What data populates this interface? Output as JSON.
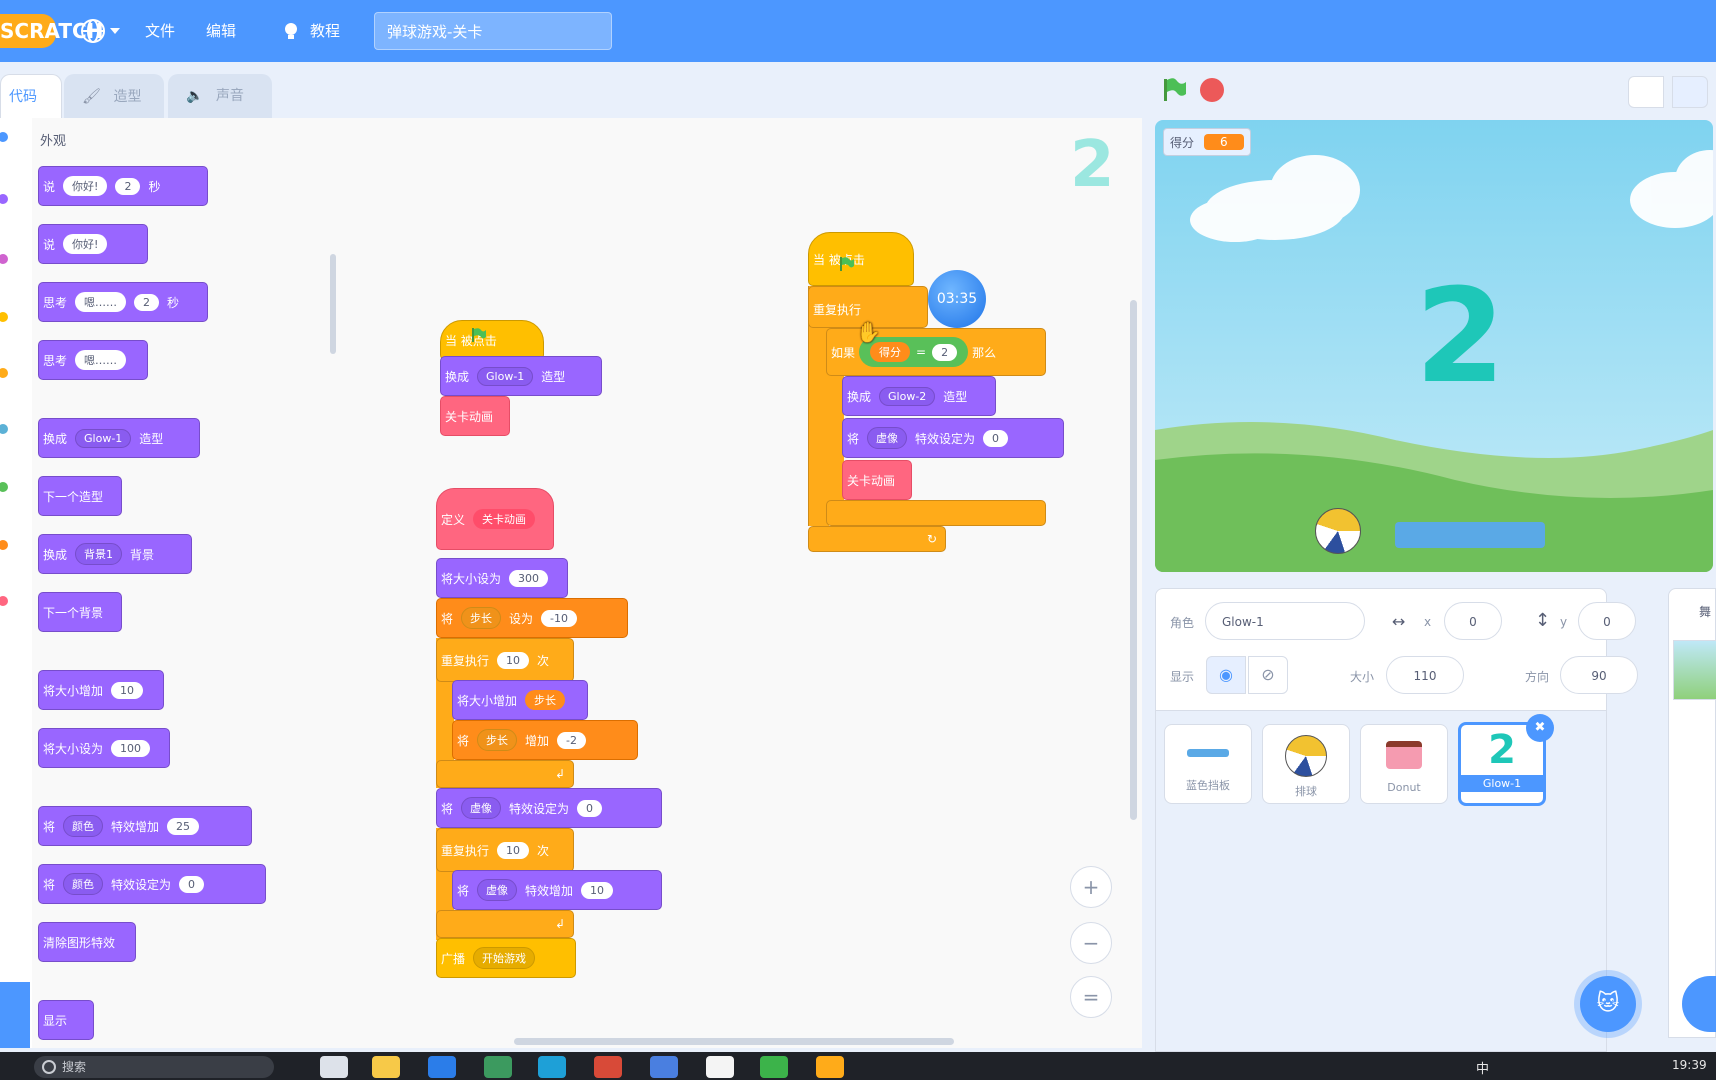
{
  "menubar": {
    "logo": "SCRATCH",
    "file": "文件",
    "edit": "编辑",
    "tutorials": "教程",
    "project_title": "弹球游戏-关卡"
  },
  "tabs": {
    "code": "代码",
    "costumes": "造型",
    "sounds": "声音"
  },
  "palette": {
    "category": "外观",
    "say_secs": {
      "op": "说",
      "text": "你好!",
      "secs": "2",
      "unit": "秒"
    },
    "say": {
      "op": "说",
      "text": "你好!"
    },
    "think_secs": {
      "op": "思考",
      "text": "嗯……",
      "secs": "2",
      "unit": "秒"
    },
    "think": {
      "op": "思考",
      "text": "嗯……"
    },
    "switch_costume": {
      "op": "换成",
      "value": "Glow-1",
      "suffix": "造型"
    },
    "next_costume": "下一个造型",
    "switch_backdrop": {
      "op": "换成",
      "value": "背景1",
      "suffix": "背景"
    },
    "next_backdrop": "下一个背景",
    "change_size": {
      "op": "将大小增加",
      "value": "10"
    },
    "set_size": {
      "op": "将大小设为",
      "value": "100"
    },
    "change_effect": {
      "op": "将",
      "effect": "颜色",
      "mid": "特效增加",
      "value": "25"
    },
    "set_effect": {
      "op": "将",
      "effect": "颜色",
      "mid": "特效设定为",
      "value": "0"
    },
    "clear_effects": "清除图形特效",
    "show": "显示"
  },
  "script1": {
    "hat": "当  被点击",
    "switch": {
      "op": "换成",
      "value": "Glow-1",
      "suffix": "造型"
    },
    "call": "关卡动画"
  },
  "script2": {
    "define": "定义",
    "define_name": "关卡动画",
    "set_size": {
      "op": "将大小设为",
      "value": "300"
    },
    "set_var": {
      "op": "将",
      "var": "步长",
      "mid": "设为",
      "value": "-10"
    },
    "repeat1": {
      "op": "重复执行",
      "value": "10",
      "suffix": "次"
    },
    "change_size": {
      "op": "将大小增加",
      "var": "步长"
    },
    "change_var": {
      "op": "将",
      "var": "步长",
      "mid": "增加",
      "value": "-2"
    },
    "set_ghost": {
      "op": "将",
      "effect": "虚像",
      "mid": "特效设定为",
      "value": "0"
    },
    "repeat2": {
      "op": "重复执行",
      "value": "10",
      "suffix": "次"
    },
    "change_ghost": {
      "op": "将",
      "effect": "虚像",
      "mid": "特效增加",
      "value": "10"
    },
    "broadcast": {
      "op": "广播",
      "value": "开始游戏"
    }
  },
  "script3": {
    "hat": "当  被点击",
    "forever": "重复执行",
    "if": "如果",
    "var": "得分",
    "eq": "=",
    "value": "2",
    "then": "那么",
    "switch": {
      "op": "换成",
      "value": "Glow-2",
      "suffix": "造型"
    },
    "set_ghost": {
      "op": "将",
      "effect": "虚像",
      "mid": "特效设定为",
      "value": "0"
    },
    "call": "关卡动画"
  },
  "timer_badge": "03:35",
  "workspace_sprite_glyph": "2",
  "stage": {
    "monitor_label": "得分",
    "monitor_value": "6",
    "glyph": "2"
  },
  "sprite_info": {
    "sprite_label": "角色",
    "sprite_name": "Glow-1",
    "x_label": "x",
    "x": "0",
    "y_label": "y",
    "y": "0",
    "show_label": "显示",
    "size_label": "大小",
    "size": "110",
    "direction_label": "方向",
    "direction": "90"
  },
  "sprites": [
    {
      "name": "蓝色挡板"
    },
    {
      "name": "排球"
    },
    {
      "name": "Donut"
    },
    {
      "name": "Glow-1"
    }
  ],
  "stage_panel": {
    "label": "舞"
  },
  "taskbar": {
    "search": "搜索",
    "ime": "中",
    "clock": "19:39"
  },
  "colors": {
    "accent": "#4c97ff",
    "looks": "#9966ff",
    "control": "#ffab19",
    "events": "#ffbf00",
    "myblocks": "#ff6680",
    "variables": "#ff8c1a"
  }
}
